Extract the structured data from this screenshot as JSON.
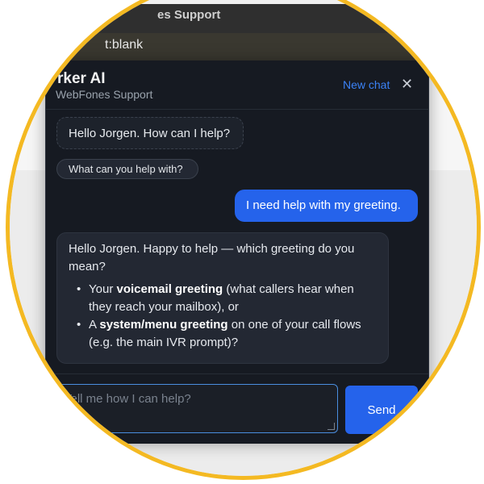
{
  "browser": {
    "tab_title_fragment": "es Support",
    "url_fragment": "t:blank"
  },
  "chat_header": {
    "title": "rker AI",
    "subtitle": "WebFones Support",
    "new_chat_label": "New chat",
    "close_glyph": "✕"
  },
  "messages": [
    {
      "role": "assistant",
      "text": "Hello Jorgen. How can I help?"
    },
    {
      "role": "suggestion",
      "text": "What can you help with?"
    },
    {
      "role": "user",
      "text": "I need help with my greeting."
    },
    {
      "role": "assistant",
      "intro": "Hello Jorgen. Happy to help — which greeting do you mean?",
      "options": [
        {
          "prefix": "Your ",
          "bold": "voicemail greeting",
          "rest": " (what callers hear when they reach your mailbox), or"
        },
        {
          "prefix": "A ",
          "bold": "system/menu greeting",
          "rest": " on one of your call flows (e.g. the main IVR prompt)?"
        }
      ]
    }
  ],
  "composer": {
    "placeholder": "Tell me how I can help?",
    "send_label": "Send"
  },
  "colors": {
    "accent": "#2563eb",
    "frame_ring": "#f4b922",
    "panel_bg": "#161a22"
  }
}
